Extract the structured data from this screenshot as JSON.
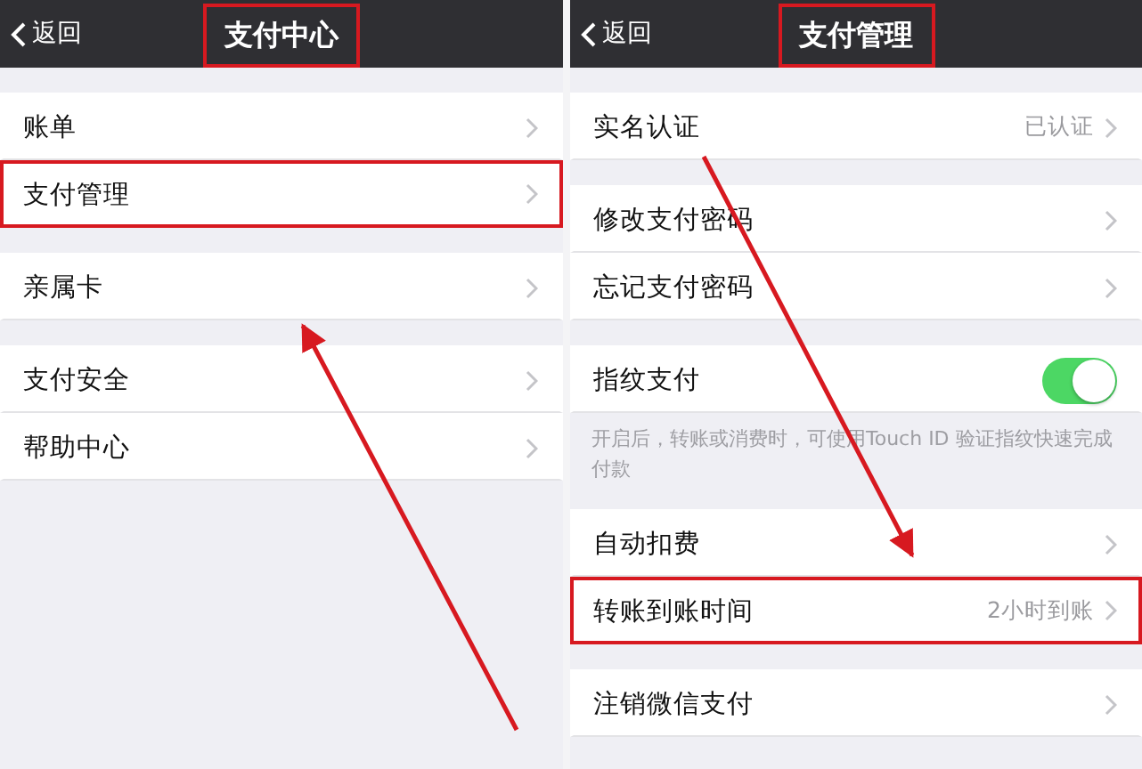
{
  "panels": [
    {
      "back": "返回",
      "title": "支付中心",
      "title_highlighted": true,
      "groups": [
        {
          "rows": [
            {
              "kind": "link",
              "label": "账单",
              "highlighted": false
            },
            {
              "kind": "link",
              "label": "支付管理",
              "highlighted": true
            }
          ]
        },
        {
          "rows": [
            {
              "kind": "link",
              "label": "亲属卡",
              "highlighted": false
            }
          ]
        },
        {
          "rows": [
            {
              "kind": "link",
              "label": "支付安全",
              "highlighted": false
            },
            {
              "kind": "link",
              "label": "帮助中心",
              "highlighted": false
            }
          ]
        }
      ]
    },
    {
      "back": "返回",
      "title": "支付管理",
      "title_highlighted": true,
      "groups": [
        {
          "rows": [
            {
              "kind": "link",
              "label": "实名认证",
              "value": "已认证",
              "highlighted": false
            }
          ]
        },
        {
          "rows": [
            {
              "kind": "link",
              "label": "修改支付密码",
              "highlighted": false
            },
            {
              "kind": "link",
              "label": "忘记支付密码",
              "highlighted": false
            }
          ]
        },
        {
          "rows": [
            {
              "kind": "toggle",
              "label": "指纹支付",
              "on": true,
              "highlighted": false
            }
          ],
          "footer": "开启后，转账或消费时，可使用Touch ID 验证指纹快速完成付款"
        },
        {
          "rows": [
            {
              "kind": "link",
              "label": "自动扣费",
              "highlighted": false
            },
            {
              "kind": "link",
              "label": "转账到账时间",
              "value": "2小时到账",
              "highlighted": true
            }
          ]
        },
        {
          "rows": [
            {
              "kind": "link",
              "label": "注销微信支付",
              "highlighted": false
            }
          ]
        }
      ]
    }
  ]
}
